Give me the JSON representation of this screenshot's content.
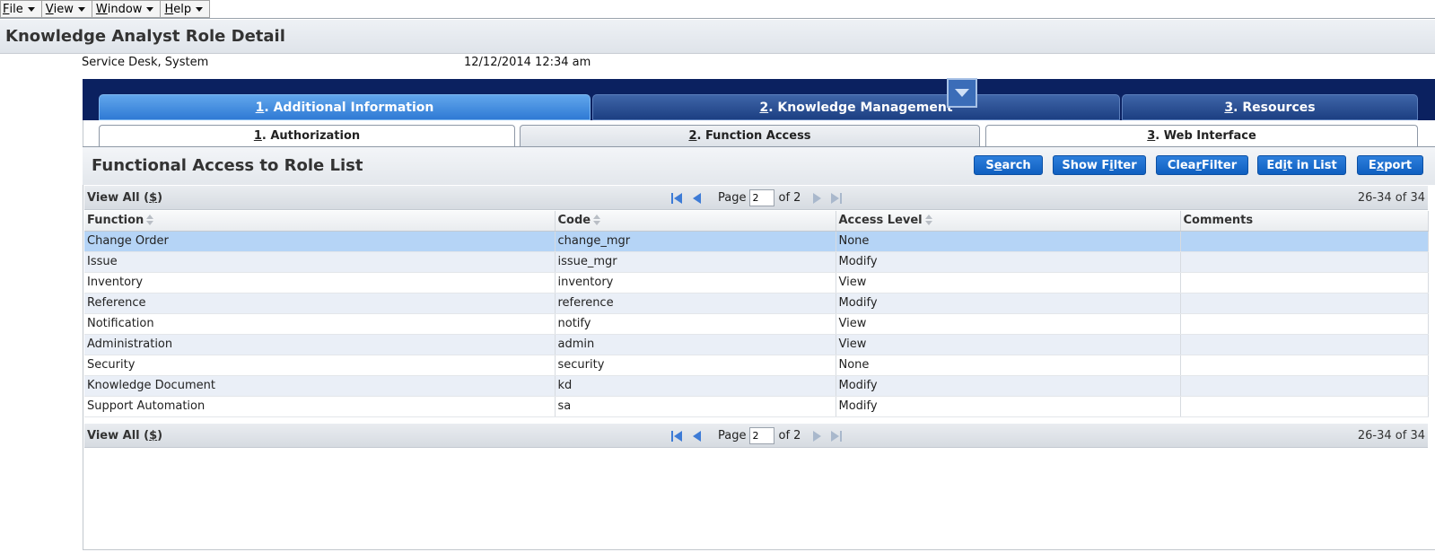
{
  "menubar": [
    {
      "accel": "F",
      "rest": "ile"
    },
    {
      "accel": "V",
      "rest": "iew"
    },
    {
      "accel": "W",
      "rest": "indow"
    },
    {
      "accel": "H",
      "rest": "elp"
    }
  ],
  "header": {
    "title": "Knowledge Analyst Role Detail",
    "user": "Service Desk, System",
    "datetime": "12/12/2014 12:34 am"
  },
  "top_tabs": [
    {
      "num": "1",
      "label": ". Additional Information"
    },
    {
      "num": "2",
      "label": ". Knowledge Management"
    },
    {
      "num": "3",
      "label": ". Resources"
    }
  ],
  "sub_tabs": [
    {
      "num": "1",
      "label": ". Authorization"
    },
    {
      "num": "2",
      "label": ". Function Access"
    },
    {
      "num": "3",
      "label": ". Web Interface"
    }
  ],
  "list": {
    "title": "Functional Access to Role List",
    "buttons": {
      "search": {
        "pre": "S",
        "acc": "e",
        "post": "arch"
      },
      "show_filter": {
        "pre": "Show F",
        "acc": "i",
        "post": "lter"
      },
      "clear_filter": {
        "pre": "Clea",
        "acc": "r",
        "post": " Filter"
      },
      "edit_in_list": {
        "pre": "Ed",
        "acc": "i",
        "post": "t in List"
      },
      "export": {
        "pre": "E",
        "acc": "x",
        "post": "port"
      }
    }
  },
  "pager": {
    "view_all_pre": "View All (",
    "view_all_acc": "$",
    "view_all_post": ")",
    "page_label": "Page",
    "page_value": "2",
    "of_label": "of 2",
    "count": "26-34 of 34"
  },
  "table": {
    "columns": [
      "Function",
      "Code",
      "Access Level",
      "Comments"
    ],
    "rows": [
      [
        "Change Order",
        "change_mgr",
        "None",
        ""
      ],
      [
        "Issue",
        "issue_mgr",
        "Modify",
        ""
      ],
      [
        "Inventory",
        "inventory",
        "View",
        ""
      ],
      [
        "Reference",
        "reference",
        "Modify",
        ""
      ],
      [
        "Notification",
        "notify",
        "View",
        ""
      ],
      [
        "Administration",
        "admin",
        "View",
        ""
      ],
      [
        "Security",
        "security",
        "None",
        ""
      ],
      [
        "Knowledge Document",
        "kd",
        "Modify",
        ""
      ],
      [
        "Support Automation",
        "sa",
        "Modify",
        ""
      ]
    ]
  },
  "colors": {
    "tab_band": "#0b2160",
    "active_tab": "#2f7ad4",
    "button": "#1a6fd0",
    "selected_row": "#b5d4f6"
  }
}
